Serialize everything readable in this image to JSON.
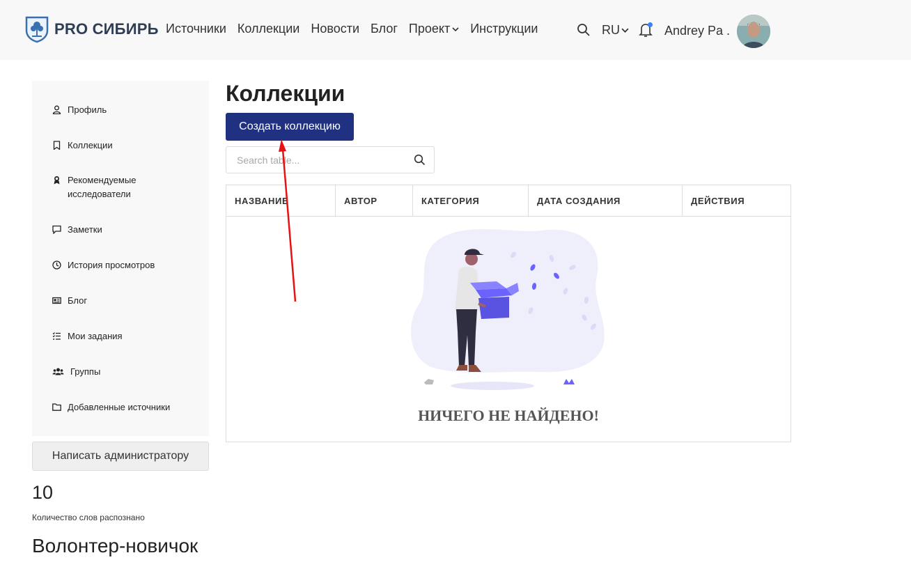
{
  "header": {
    "logo_text": "PRO СИБИРЬ",
    "nav": [
      "Источники",
      "Коллекции",
      "Новости",
      "Блог",
      "Проект",
      "Инструкции"
    ],
    "language": "RU",
    "user_name": "Andrey Pa ."
  },
  "sidebar": {
    "items": [
      {
        "label": "Профиль",
        "icon": "user-icon"
      },
      {
        "label": "Коллекции",
        "icon": "bookmark-icon"
      },
      {
        "label": "Рекомендуемые исследователи",
        "icon": "award-icon"
      },
      {
        "label": "Заметки",
        "icon": "comment-icon"
      },
      {
        "label": "История просмотров",
        "icon": "clock-icon"
      },
      {
        "label": "Блог",
        "icon": "newspaper-icon"
      },
      {
        "label": "Мои задания",
        "icon": "tasks-icon"
      },
      {
        "label": "Группы",
        "icon": "users-icon"
      },
      {
        "label": "Добавленные источники",
        "icon": "folder-icon"
      }
    ],
    "write_admin_label": "Написать администратору",
    "word_count": "10",
    "word_count_label": "Количество слов распознано",
    "rank": "Волонтер-новичок"
  },
  "main": {
    "title": "Коллекции",
    "create_label": "Создать коллекцию",
    "search_placeholder": "Search table...",
    "columns": [
      "НАЗВАНИЕ",
      "АВТОР",
      "КАТЕГОРИЯ",
      "ДАТА СОЗДАНИЯ",
      "ДЕЙСТВИЯ"
    ],
    "empty_text": "НИЧЕГО НЕ НАЙДЕНО!"
  },
  "colors": {
    "primary_button": "#1f3180",
    "annotation_arrow": "#e81010",
    "illustration_accent": "#6c63ff"
  }
}
